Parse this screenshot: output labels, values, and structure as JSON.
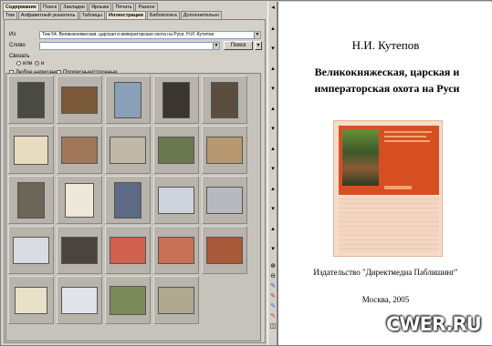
{
  "tabs_row1": [
    "Содержание",
    "Поиск",
    "Закладки",
    "Ярлыки",
    "Печать",
    "Разное"
  ],
  "tabs_row2": [
    "Том",
    "Алфавитный указатель",
    "Таблицы",
    "Иллюстрации",
    "Библиотека",
    "Дополнительно"
  ],
  "active_tab": "Иллюстрации",
  "search": {
    "from_label": "Из",
    "from_value": "Том 54. Великокняжеская, царская и императорская охота на Руси. Н.И. Кутепов",
    "word_label": "Слово",
    "word_value": "",
    "search_button": "Поиск",
    "bind_label": "Связать",
    "or_label": "или",
    "and_label": "и",
    "any_spelling": "Любое написание",
    "case_sensitive": "Прописные/строчные"
  },
  "thumbnails": [
    {
      "bg": "#4a4a44"
    },
    {
      "bg": "#7a5a3a"
    },
    {
      "bg": "#8aa0b8"
    },
    {
      "bg": "#3a3530"
    },
    {
      "bg": "#5a4e40"
    },
    {
      "bg": "#e8dcc0"
    },
    {
      "bg": "#a07858"
    },
    {
      "bg": "#c0b8a8"
    },
    {
      "bg": "#6a7850"
    },
    {
      "bg": "#b89870"
    },
    {
      "bg": "#6b6658"
    },
    {
      "bg": "#efe8da"
    },
    {
      "bg": "#5c6a86"
    },
    {
      "bg": "#cfd4dc"
    },
    {
      "bg": "#b8b8c0"
    },
    {
      "bg": "#d8dce0"
    },
    {
      "bg": "#4a4440"
    },
    {
      "bg": "#d06050"
    },
    {
      "bg": "#c87058"
    },
    {
      "bg": "#a85a3a"
    },
    {
      "bg": "#e8e0c8"
    },
    {
      "bg": "#e0e4ea"
    },
    {
      "bg": "#7a8a5a"
    },
    {
      "bg": "#b0a890"
    }
  ],
  "page": {
    "author": "Н.И. Кутепов",
    "title": "Великокняжеская, царская и императорская охота на Руси",
    "publisher": "Издательство \"Директмедиа Паблишинг\"",
    "city_year": "Москва, 2005"
  },
  "watermark": "CWER.RU"
}
